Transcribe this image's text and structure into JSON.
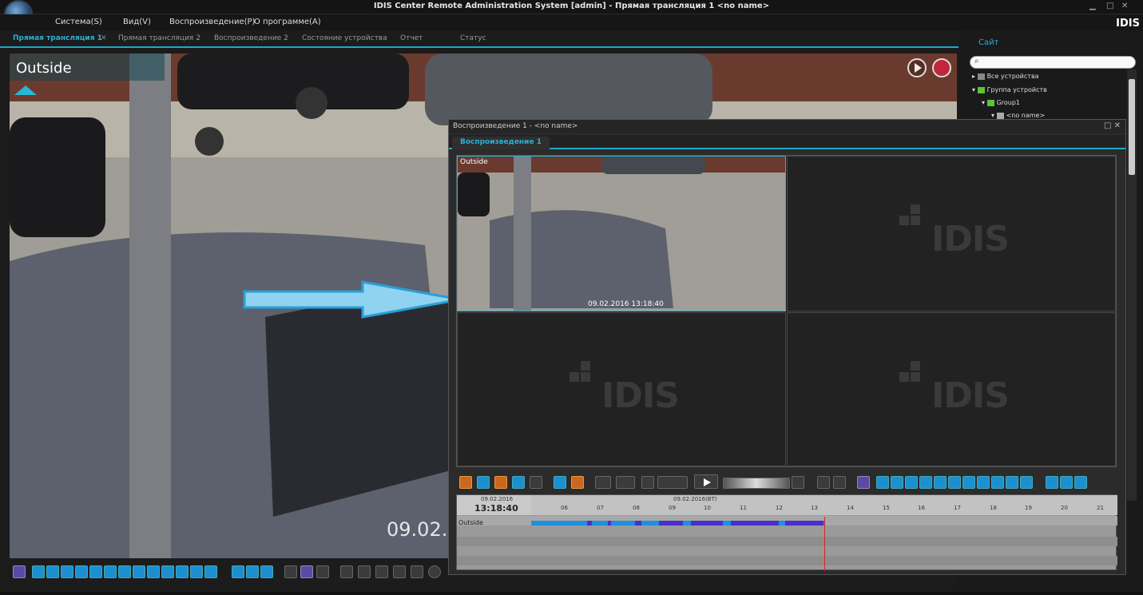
{
  "window": {
    "title": "IDIS Center Remote Administration System [admin] - Прямая трансляция 1  <no name>"
  },
  "menu": [
    "Система(S)",
    "Вид(V)",
    "Воспроизведение(P)",
    "О программе(A)"
  ],
  "brand": "IDIS",
  "tabs": [
    {
      "label": "Прямая трансляция 1",
      "active": true
    },
    {
      "label": "Прямая трансляция 2"
    },
    {
      "label": "Воспроизведение 2"
    },
    {
      "label": "Состояние устройства"
    },
    {
      "label": "Отчет"
    },
    {
      "label": "Статус"
    }
  ],
  "live": {
    "camera_label": "Outside",
    "timestamp": "09.02.2"
  },
  "sidebar": {
    "title": "Сайт",
    "search_value": "",
    "tree": [
      "Все устройства",
      "Группа устройств",
      "Group1",
      "<no name>"
    ]
  },
  "playback": {
    "window_title": "Воспроизведение 1 - <no name>",
    "tab": "Воспроизведение 1",
    "cell1_label": "Outside",
    "cell1_time": "09.02.2016 13:18:40",
    "watermark": "IDIS",
    "timeline": {
      "date": "09.02.2016",
      "time": "13:18:40",
      "dst_label": "09.02.2016(BT)",
      "hours": [
        "06",
        "07",
        "08",
        "09",
        "10",
        "11",
        "12",
        "13",
        "14",
        "15",
        "16",
        "17",
        "18",
        "19",
        "20",
        "21"
      ],
      "row_label": "Outside",
      "recorded_until_hour": "13:18:40"
    }
  },
  "colors": {
    "accent": "#29b6d6",
    "record": "#c2263a",
    "timeline_bar": "#1e90e0",
    "timeline_event": "#4a2fd0",
    "cursor": "#e02020"
  }
}
